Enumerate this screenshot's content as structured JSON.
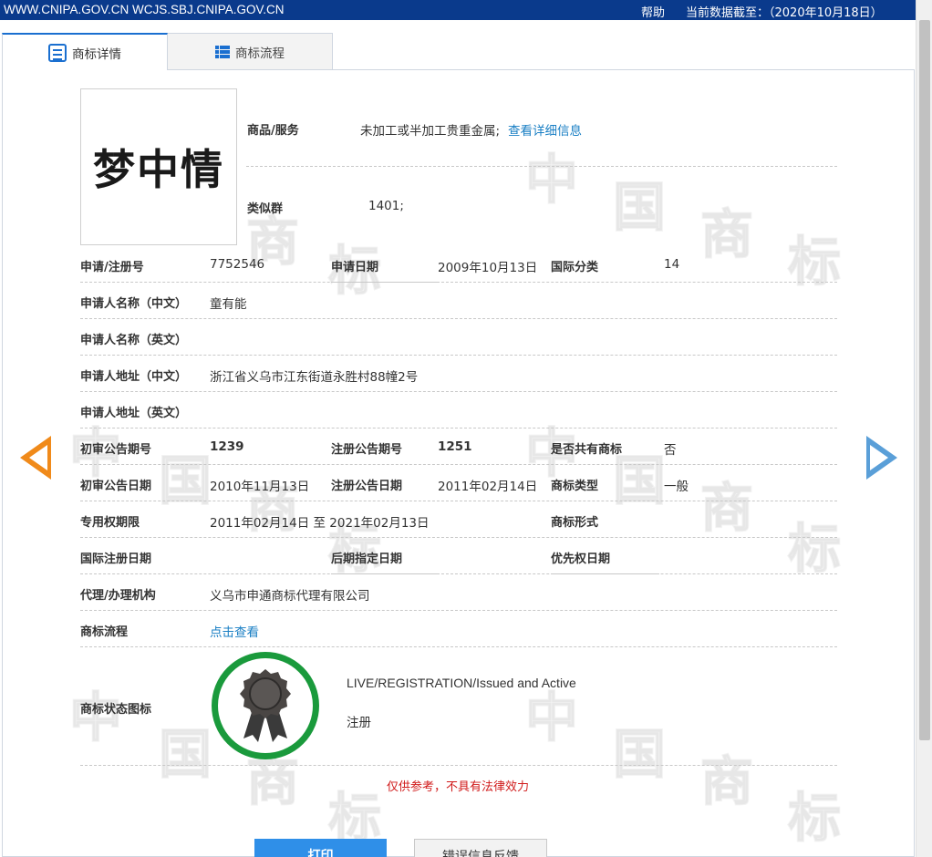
{
  "topbar": {
    "site_urls": "WWW.CNIPA.GOV.CN WCJS.SBJ.CNIPA.GOV.CN",
    "help_label": "帮助",
    "data_date": "当前数据截至：（2020年10月18日）"
  },
  "tabs": [
    {
      "label": "商标详情",
      "icon": "document-list-icon",
      "active": true
    },
    {
      "label": "商标流程",
      "icon": "list-icon",
      "active": false
    }
  ],
  "watermark_chars": [
    "中",
    "国",
    "商",
    "标"
  ],
  "trademark": {
    "name": "梦中情"
  },
  "goods": {
    "label": "商品/服务",
    "value": "未加工或半加工贵重金属;",
    "link": "查看详细信息"
  },
  "similar_group": {
    "label": "类似群",
    "value": "1401;"
  },
  "fields": {
    "reg_no_label": "申请/注册号",
    "reg_no": "7752546",
    "apply_date_label": "申请日期",
    "apply_date": "2009年10月13日",
    "intl_class_label": "国际分类",
    "intl_class": "14",
    "applicant_cn_label": "申请人名称（中文）",
    "applicant_cn": "童有能",
    "applicant_en_label": "申请人名称（英文）",
    "address_cn_label": "申请人地址（中文）",
    "address_cn": "浙江省义乌市江东街道永胜村88幢2号",
    "address_en_label": "申请人地址（英文）",
    "prelim_issue_label": "初审公告期号",
    "prelim_issue": "1239",
    "reg_issue_label": "注册公告期号",
    "reg_issue": "1251",
    "shared_label": "是否共有商标",
    "shared": "否",
    "prelim_date_label": "初审公告日期",
    "prelim_date": "2010年11月13日",
    "reg_date_label": "注册公告日期",
    "reg_date": "2011年02月14日",
    "tm_type_label": "商标类型",
    "tm_type": "一般",
    "exclusive_label": "专用权期限",
    "exclusive": "2011年02月14日 至 2021年02月13日",
    "tm_form_label": "商标形式",
    "intl_reg_date_label": "国际注册日期",
    "later_date_label": "后期指定日期",
    "priority_date_label": "优先权日期",
    "agent_label": "代理/办理机构",
    "agent": "义乌市申通商标代理有限公司",
    "flow_label": "商标流程",
    "flow_link": "点击查看",
    "status_label": "商标状态图标",
    "status_en": "LIVE/REGISTRATION/Issued and Active",
    "status_cn": "注册"
  },
  "colors": {
    "topbar": "#0a3a8c",
    "link": "#1a7fc4",
    "status_ring": "#1a9a3c",
    "notice": "#d01a1a",
    "primary_button": "#2f8fe8",
    "prev_arrow": "#f08a1a",
    "next_arrow": "#5a9fd8"
  },
  "notice": "仅供参考，不具有法律效力",
  "buttons": {
    "print": "打印",
    "report": "错误信息反馈"
  }
}
